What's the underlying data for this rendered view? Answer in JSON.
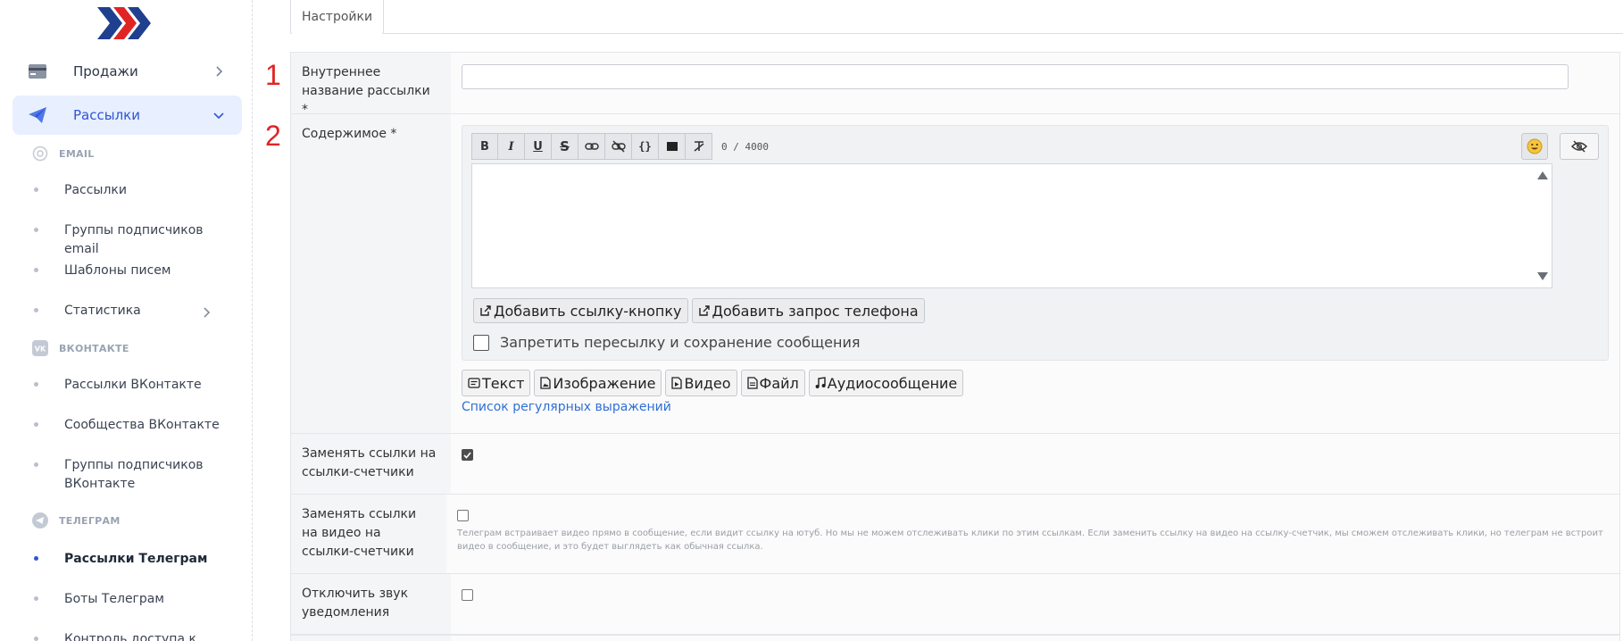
{
  "sidebar": {
    "menu": [
      {
        "label": "Продажи",
        "icon": "credit-card-icon"
      },
      {
        "label": "Рассылки",
        "icon": "paper-plane-icon"
      }
    ],
    "sections": [
      {
        "title": "EMAIL",
        "icon": "at-sign-icon",
        "items": [
          {
            "label": "Рассылки"
          },
          {
            "label": "Группы подписчиков email"
          },
          {
            "label": "Шаблоны писем"
          },
          {
            "label": "Статистика"
          }
        ]
      },
      {
        "title": "ВКОНТАКТЕ",
        "icon": "vk-icon",
        "items": [
          {
            "label": "Рассылки ВКонтакте"
          },
          {
            "label": "Сообщества ВКонтакте"
          },
          {
            "label": "Группы подписчиков ВКонтакте"
          }
        ]
      },
      {
        "title": "ТЕЛЕГРАМ",
        "icon": "telegram-icon",
        "items": [
          {
            "label": "Рассылки Телеграм",
            "active": true
          },
          {
            "label": "Боты Телеграм"
          },
          {
            "label": "Контроль доступа к"
          }
        ]
      }
    ]
  },
  "tabs": [
    {
      "label": "Настройки",
      "active": true
    }
  ],
  "markers": [
    "1",
    "2"
  ],
  "form": {
    "name_label": "Внутреннее название рассылки *",
    "name_value": "",
    "content_label": "Содержимое *",
    "counter": "0 / 4000",
    "toolbar": [
      "B",
      "I",
      "U",
      "S",
      "link",
      "unlink",
      "{}",
      "block",
      "clear-format"
    ],
    "add_link_button": "Добавить ссылку-кнопку",
    "add_phone_button": "Добавить запрос телефона",
    "forbid_forward_label": "Запретить пересылку и сохранение сообщения",
    "forbid_forward_checked": false,
    "media_buttons": [
      "Текст",
      "Изображение",
      "Видео",
      "Файл",
      "Аудиосообщение"
    ],
    "regex_link": "Список регулярных выражений",
    "replace_links_label": "Заменять ссылки на ссылки-счетчики",
    "replace_links_checked": true,
    "replace_video_label": "Заменять ссылки на видео на ссылки-счетчики",
    "replace_video_checked": false,
    "replace_video_hint": "Телеграм встраивает видео прямо в сообщение, если видит ссылку на ютуб. Но мы не можем отслеживать клики по этим ссылкам. Если заменить ссылку на видео на ссылку-счетчик, мы сможем отслеживать клики, но телеграм не встроит видео в сообщение, и это будет выглядеть как обычная ссылка.",
    "mute_label": "Отключить звук уведомления",
    "mute_checked": false
  },
  "colors": {
    "accent": "#2f55d4",
    "active_bg": "#e8efff",
    "marker": "#e02424",
    "link": "#2f6fd6"
  }
}
